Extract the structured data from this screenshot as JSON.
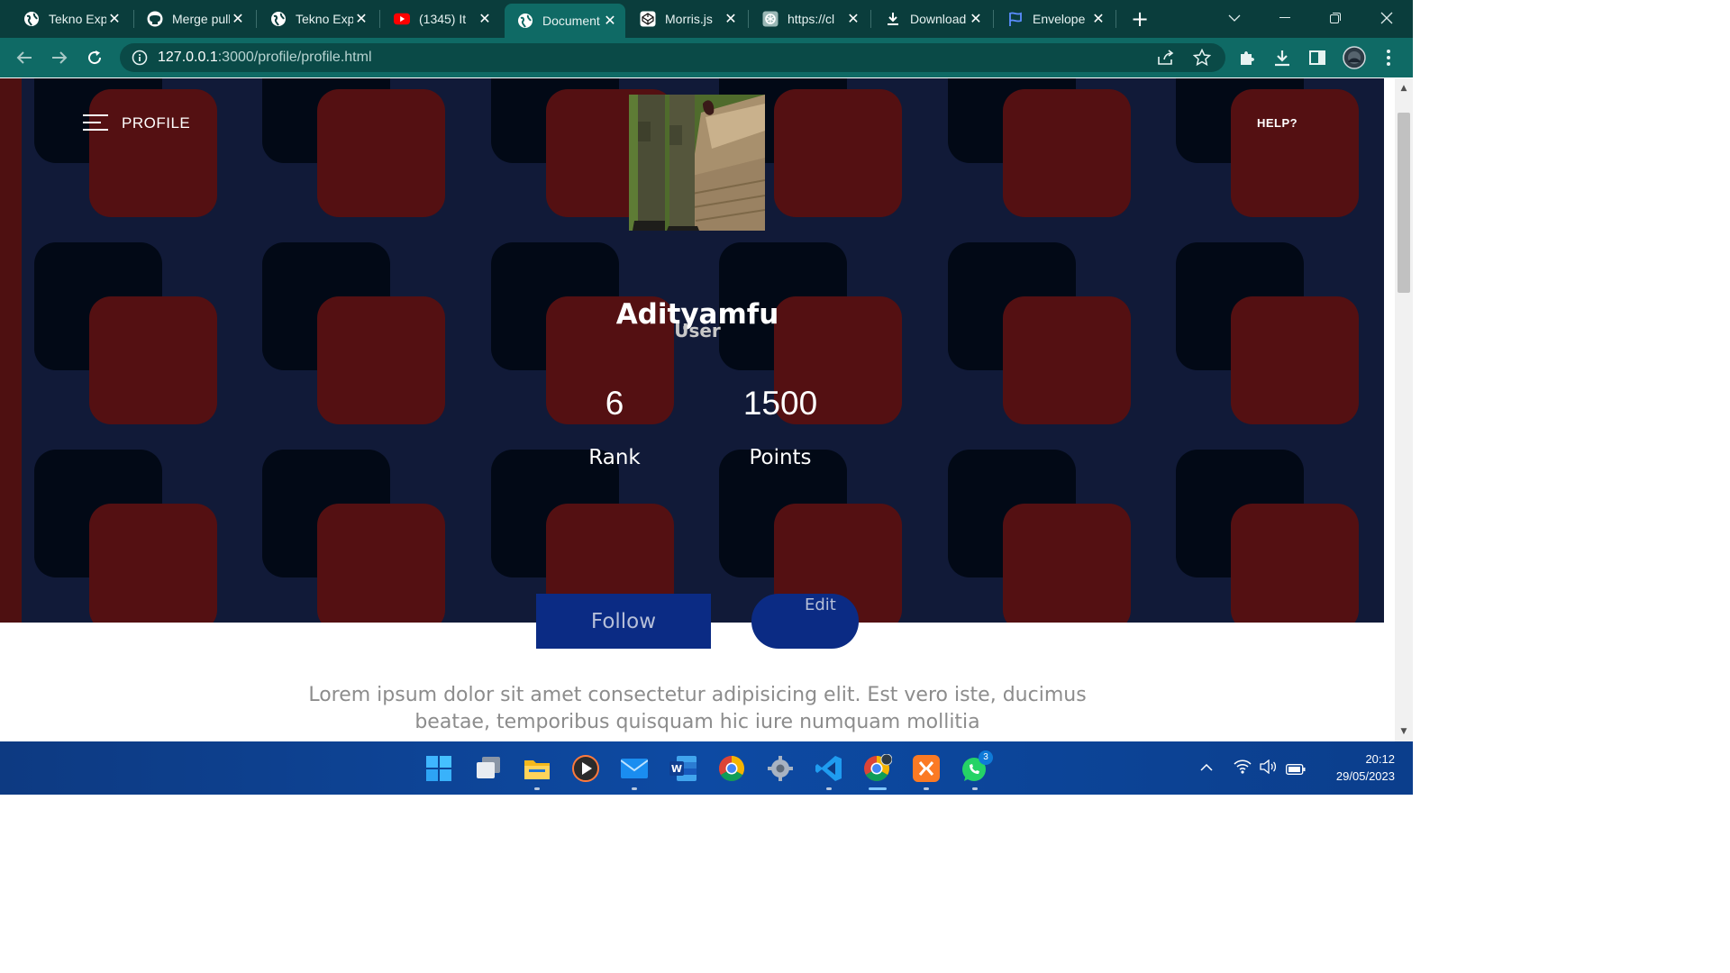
{
  "browser": {
    "tabs": [
      {
        "label": "Tekno Exp",
        "icon": "globe-icon"
      },
      {
        "label": "Merge pull",
        "icon": "github-icon"
      },
      {
        "label": "Tekno Exp",
        "icon": "globe-icon"
      },
      {
        "label": "(1345) It",
        "icon": "youtube-icon"
      },
      {
        "label": "Document",
        "icon": "globe-icon",
        "active": true
      },
      {
        "label": "Morris.js",
        "icon": "codepen-icon"
      },
      {
        "label": "https://cl",
        "icon": "openai-icon"
      },
      {
        "label": "Download",
        "icon": "download-icon"
      },
      {
        "label": "Envelope",
        "icon": "flag-icon"
      }
    ],
    "url_host": "127.0.0.1",
    "url_rest": ":3000/profile/profile.html"
  },
  "page": {
    "nav_title": "PROFILE",
    "help_label": "HELP?",
    "username": "Adityamfu",
    "role": "User",
    "stats": [
      {
        "value": "6",
        "label": "Rank"
      },
      {
        "value": "1500",
        "label": "Points"
      }
    ],
    "follow_label": "Follow",
    "edit_label": "Edit",
    "bio": "Lorem ipsum dolor sit amet consectetur adipisicing elit. Est vero iste, ducimus beatae, temporibus quisquam hic iure numquam mollitia"
  },
  "colors": {
    "hero_bg": "#111a38",
    "tile_red": "#541012",
    "tile_dark": "#020916",
    "button": "#0b2b84",
    "browser_frame": "#0a3d3c",
    "toolbar": "#0f6a65"
  },
  "taskbar": {
    "apps": [
      "windows-start-icon",
      "task-view-icon",
      "file-explorer-icon",
      "media-player-icon",
      "mail-icon",
      "word-icon",
      "chrome-icon",
      "settings-icon",
      "vscode-icon",
      "chrome-profile-icon",
      "xampp-icon",
      "whatsapp-icon"
    ],
    "whatsapp_badge": "3",
    "time": "20:12",
    "date": "29/05/2023"
  }
}
